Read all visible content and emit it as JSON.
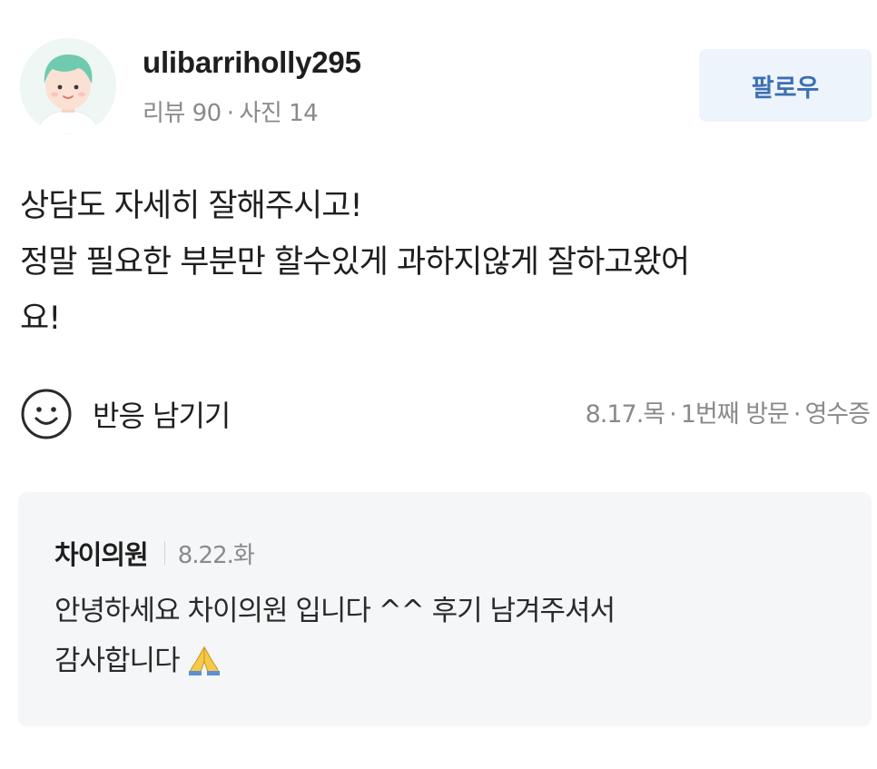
{
  "profile": {
    "username": "ulibarriholly295",
    "reviews": "리뷰 90",
    "separator": "·",
    "photos": "사진 14",
    "follow_label": "팔로우",
    "avatar_icon": "user-avatar-icon"
  },
  "review": {
    "lines": [
      "상담도 자세히 잘해주시고!",
      "정말 필요한 부분만 할수있게 과하지않게 잘하고왔어",
      "요!"
    ]
  },
  "reaction": {
    "icon": "smile-icon",
    "label": "반응 남기기"
  },
  "visit": {
    "date": "8.17.목",
    "separator": "·",
    "visit_count": "1번째 방문",
    "receipt": "영수증"
  },
  "reply": {
    "author": "차이의원",
    "date": "8.22.화",
    "lines": [
      "안녕하세요 차이의원 입니다 ^^ 후기 남겨주셔서",
      "감사합니다"
    ],
    "emoji_icon": "folded-hands-icon"
  },
  "colors": {
    "accent": "#3d6fb4",
    "follow_bg": "#eef4fb",
    "muted_text": "#8a8a8a",
    "reply_bg": "#f4f6f8"
  }
}
